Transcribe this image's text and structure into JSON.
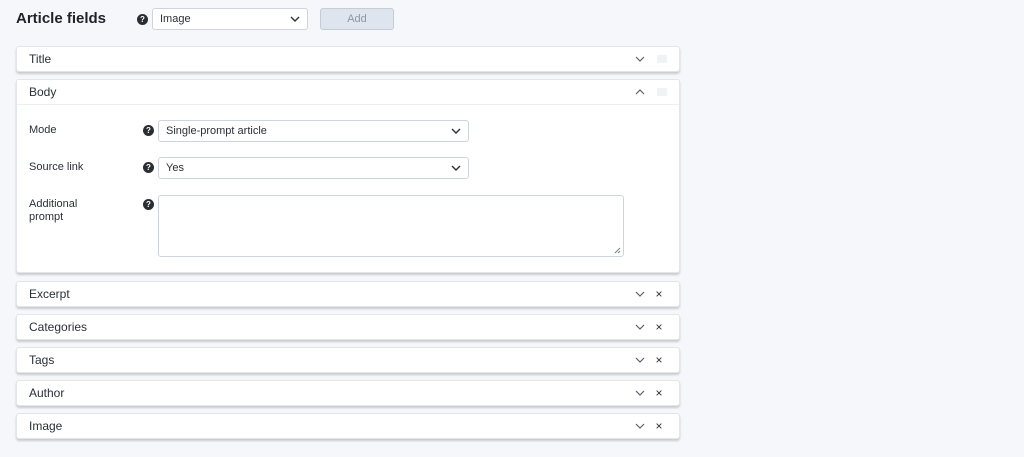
{
  "header": {
    "title": "Article fields",
    "help_glyph": "?",
    "field_type_select": "Image",
    "add_label": "Add"
  },
  "panels": [
    {
      "label": "Title",
      "expanded": false,
      "removable": false
    },
    {
      "label": "Body",
      "expanded": true,
      "removable": false
    },
    {
      "label": "Excerpt",
      "expanded": false,
      "removable": true
    },
    {
      "label": "Categories",
      "expanded": false,
      "removable": true
    },
    {
      "label": "Tags",
      "expanded": false,
      "removable": true
    },
    {
      "label": "Author",
      "expanded": false,
      "removable": true
    },
    {
      "label": "Image",
      "expanded": false,
      "removable": true
    }
  ],
  "body_fields": {
    "mode": {
      "label": "Mode",
      "value": "Single-prompt article"
    },
    "source_link": {
      "label": "Source link",
      "value": "Yes"
    },
    "additional_prompt": {
      "label_line1": "Additional",
      "label_line2": "prompt",
      "value": ""
    }
  },
  "close_glyph": "×",
  "icons": {
    "chevron": "chevron-down-icon",
    "chevron_up": "chevron-up-icon",
    "close": "close-icon",
    "help": "help-icon"
  }
}
